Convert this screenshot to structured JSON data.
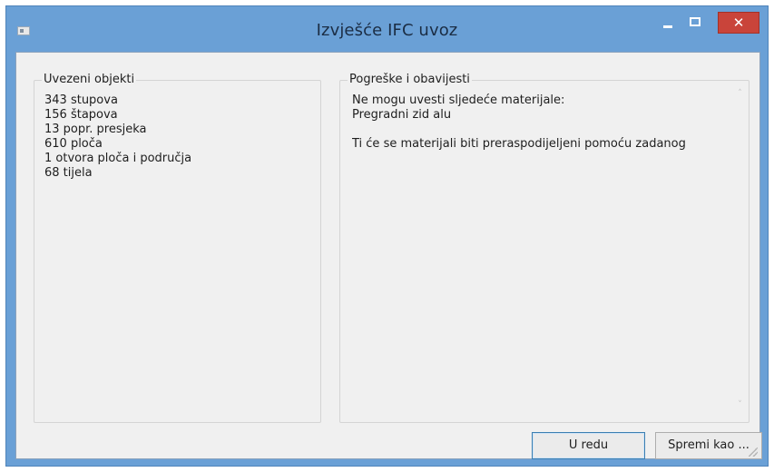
{
  "window": {
    "title": "Izvješće IFC uvoz",
    "controls": {
      "minimize_icon": "minimize-icon",
      "maximize_icon": "maximize-icon",
      "close_label": "✕"
    }
  },
  "imported_objects": {
    "label": "Uvezeni objekti",
    "items": [
      "343 stupova",
      "156 štapova",
      "13 popr. presjeka",
      "610 ploča",
      "1 otvora ploča i područja",
      "68 tijela"
    ]
  },
  "errors": {
    "label": "Pogreške i obavijesti",
    "lines": [
      "Ne mogu uvesti sljedeće materijale:",
      "Pregradni zid alu",
      "",
      "Ti će se materijali biti preraspodijeljeni pomoću zadanog"
    ],
    "scroll_up": "˄",
    "scroll_down": "˅"
  },
  "buttons": {
    "ok": "U redu",
    "save": "Spremi kao ..."
  },
  "colors": {
    "titlebar": "#6aa0d6",
    "close": "#c9443a",
    "client": "#f0f0f0",
    "default_button_border": "#3c7fb1"
  }
}
